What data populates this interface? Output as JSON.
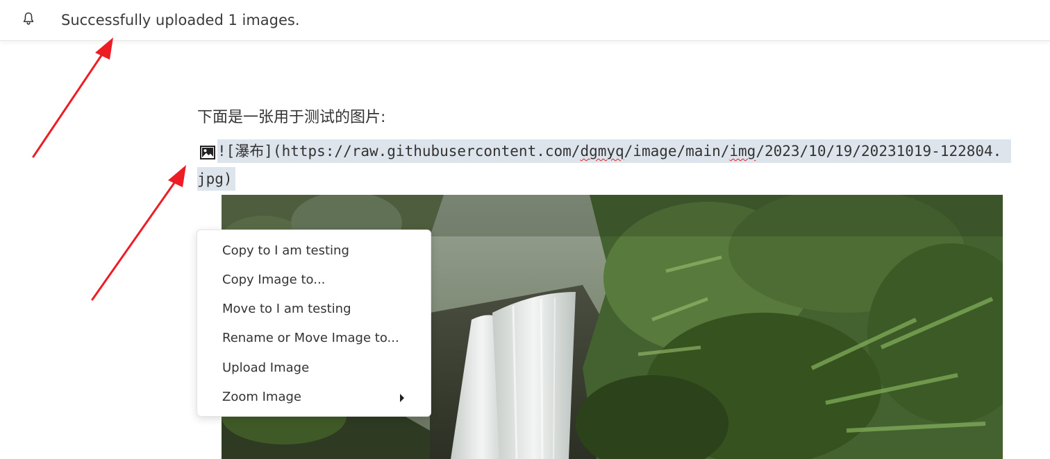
{
  "notification": {
    "icon": "bell-icon",
    "message": "Successfully uploaded 1 images."
  },
  "editor": {
    "paragraph": "下面是一张用于测试的图片:",
    "markdown_image": {
      "icon": "image-icon",
      "part1": "![瀑布](https://raw.githubusercontent.com/",
      "part2": "dgmyq",
      "part3": "/image/main/",
      "part4": "img",
      "part5": "/2023/10/19/20231019-122804.",
      "line2": "jpg)"
    }
  },
  "context_menu": {
    "items": [
      {
        "label": "Copy to I am testing"
      },
      {
        "label": "Copy Image to..."
      },
      {
        "label": "Move to I am testing"
      },
      {
        "label": "Rename or Move Image to..."
      },
      {
        "label": "Upload Image"
      },
      {
        "label": "Zoom Image",
        "has_submenu": true
      }
    ]
  },
  "colors": {
    "selection_bg": "#dde4ec",
    "spellcheck": "#e0201a",
    "annotation_arrow": "#ee1c24"
  }
}
